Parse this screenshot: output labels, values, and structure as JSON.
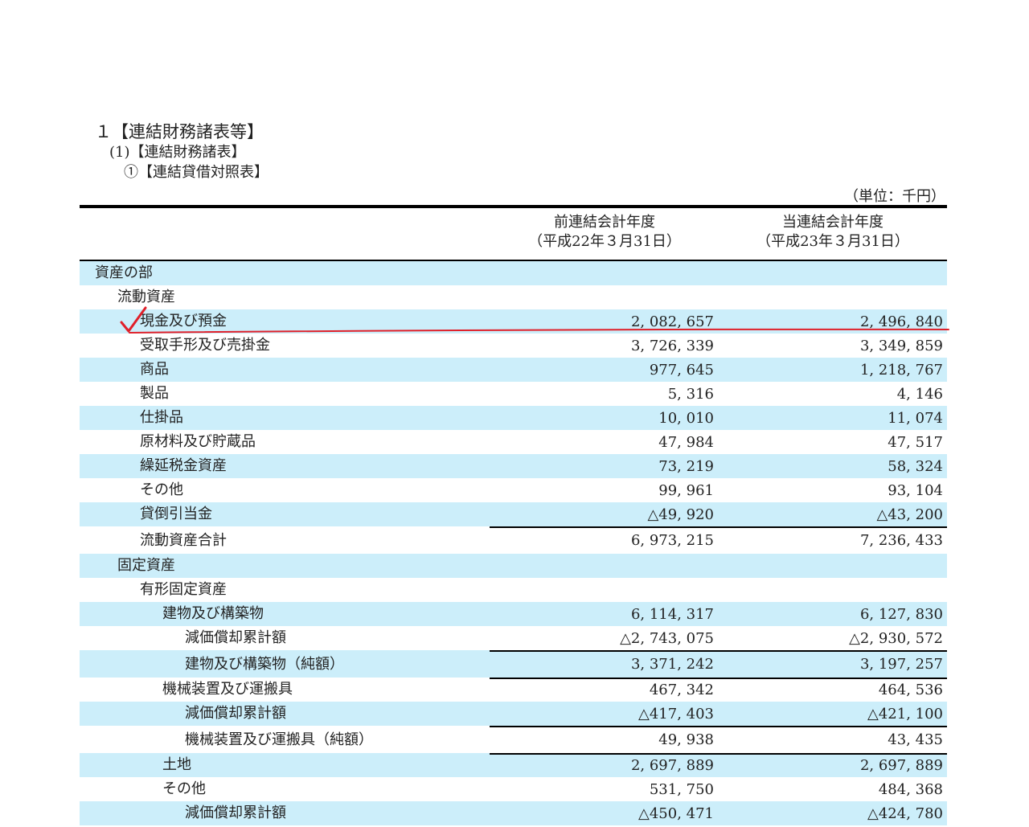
{
  "headings": {
    "h1": "１【連結財務諸表等】",
    "h2": "(1)【連結財務諸表】",
    "h3": "①【連結貸借対照表】"
  },
  "unit": "（単位：千円）",
  "columns": [
    {
      "line1": "前連結会計年度",
      "line2": "（平成22年３月31日）"
    },
    {
      "line1": "当連結会計年度",
      "line2": "（平成23年３月31日）"
    }
  ],
  "rows": [
    {
      "label": "資産の部",
      "v1": "",
      "v2": ""
    },
    {
      "label": "流動資産",
      "v1": "",
      "v2": ""
    },
    {
      "label": "現金及び預金",
      "v1": "2, 082, 657",
      "v2": "2, 496, 840"
    },
    {
      "label": "受取手形及び売掛金",
      "v1": "3, 726, 339",
      "v2": "3, 349, 859"
    },
    {
      "label": "商品",
      "v1": "977, 645",
      "v2": "1, 218, 767"
    },
    {
      "label": "製品",
      "v1": "5, 316",
      "v2": "4, 146"
    },
    {
      "label": "仕掛品",
      "v1": "10, 010",
      "v2": "11, 074"
    },
    {
      "label": "原材料及び貯蔵品",
      "v1": "47, 984",
      "v2": "47, 517"
    },
    {
      "label": "繰延税金資産",
      "v1": "73, 219",
      "v2": "58, 324"
    },
    {
      "label": "その他",
      "v1": "99, 961",
      "v2": "93, 104"
    },
    {
      "label": "貸倒引当金",
      "v1": "△49, 920",
      "v2": "△43, 200"
    },
    {
      "label": "流動資産合計",
      "v1": "6, 973, 215",
      "v2": "7, 236, 433"
    },
    {
      "label": "固定資産",
      "v1": "",
      "v2": ""
    },
    {
      "label": "有形固定資産",
      "v1": "",
      "v2": ""
    },
    {
      "label": "建物及び構築物",
      "v1": "6, 114, 317",
      "v2": "6, 127, 830"
    },
    {
      "label": "減価償却累計額",
      "v1": "△2, 743, 075",
      "v2": "△2, 930, 572"
    },
    {
      "label": "建物及び構築物（純額）",
      "v1": "3, 371, 242",
      "v2": "3, 197, 257"
    },
    {
      "label": "機械装置及び運搬具",
      "v1": "467, 342",
      "v2": "464, 536"
    },
    {
      "label": "減価償却累計額",
      "v1": "△417, 403",
      "v2": "△421, 100"
    },
    {
      "label": "機械装置及び運搬具（純額）",
      "v1": "49, 938",
      "v2": "43, 435"
    },
    {
      "label": "土地",
      "v1": "2, 697, 889",
      "v2": "2, 697, 889"
    },
    {
      "label": "その他",
      "v1": "531, 750",
      "v2": "484, 368"
    },
    {
      "label": "減価償却累計額",
      "v1": "△450, 471",
      "v2": "△424, 780"
    }
  ],
  "annotation_color": "#e0202a"
}
